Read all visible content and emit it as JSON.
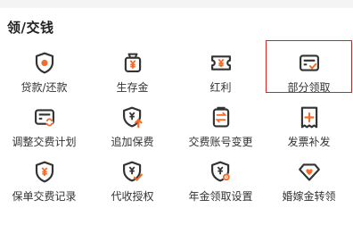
{
  "section": {
    "title": "领/交钱"
  },
  "colors": {
    "icon_dark": "#333333",
    "accent": "#f26c2c",
    "highlight_border": "#e02020"
  },
  "items": [
    {
      "label": "贷款/还款",
      "icon": "shield-circle-icon",
      "highlighted": false
    },
    {
      "label": "生存金",
      "icon": "money-bag-icon",
      "highlighted": false
    },
    {
      "label": "红利",
      "icon": "ticket-yen-icon",
      "highlighted": false
    },
    {
      "label": "部分领取",
      "icon": "card-check-icon",
      "highlighted": true
    },
    {
      "label": "调整交费计划",
      "icon": "card-refresh-icon",
      "highlighted": false
    },
    {
      "label": "追加保费",
      "icon": "shield-yen-up-icon",
      "highlighted": false
    },
    {
      "label": "交费账号变更",
      "icon": "clipboard-swap-icon",
      "highlighted": false
    },
    {
      "label": "发票补发",
      "icon": "receipt-plus-icon",
      "highlighted": false
    },
    {
      "label": "保单交费记录",
      "icon": "shield-yen-icon",
      "highlighted": false
    },
    {
      "label": "代收授权",
      "icon": "shield-yen-check-icon",
      "highlighted": false
    },
    {
      "label": "年金领取设置",
      "icon": "shield-yen-gear-icon",
      "highlighted": false
    },
    {
      "label": "婚嫁金转领",
      "icon": "heart-gem-icon",
      "highlighted": false
    }
  ]
}
